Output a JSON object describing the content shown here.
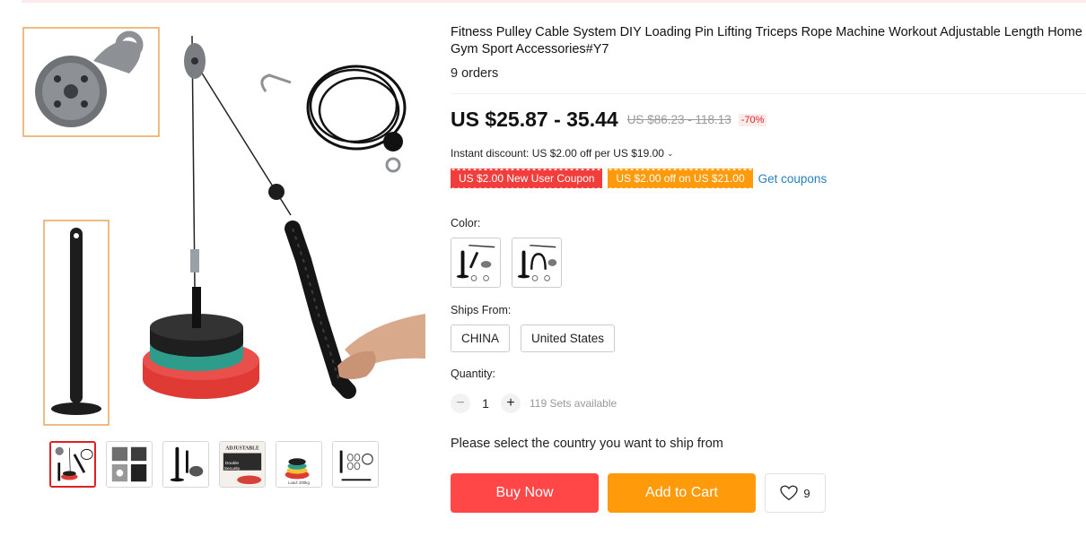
{
  "product": {
    "title": "Fitness Pulley Cable System DIY Loading Pin Lifting Triceps Rope Machine Workout Adjustable Length Home Gym Sport Accessories#Y7",
    "orders": "9 orders"
  },
  "price": {
    "current": "US $25.87 - 35.44",
    "original": "US $86.23 - 118.13",
    "discount": "-70%"
  },
  "instant_discount": "Instant discount: US $2.00 off per US $19.00",
  "coupons": [
    {
      "label": "US $2.00 New User Coupon",
      "color": "#f23d3d"
    },
    {
      "label": "US $2.00 off on US $21.00",
      "color": "#ff9a0a"
    }
  ],
  "get_coupons": "Get coupons",
  "color_label": "Color:",
  "ships_from_label": "Ships From:",
  "ships_from_options": [
    "CHINA",
    "United States"
  ],
  "quantity_label": "Quantity:",
  "quantity": {
    "value": "1",
    "minus": "−",
    "plus": "+",
    "available": "119 Sets available"
  },
  "ship_note": "Please select the country you want to ship from",
  "buttons": {
    "buy_now": "Buy Now",
    "add_to_cart": "Add to Cart"
  },
  "wishlist_count": "9",
  "gallery": {
    "thumb_texts": {
      "adjustable": "ADJUSTABLE",
      "double": "Double",
      "security": "Security",
      "load": "Load: 200kg"
    }
  },
  "colors": {
    "accent_red": "#ff4747",
    "accent_orange": "#ff9a0a",
    "link_blue": "#2a7fb8",
    "active_thumb_border": "#e02020"
  }
}
